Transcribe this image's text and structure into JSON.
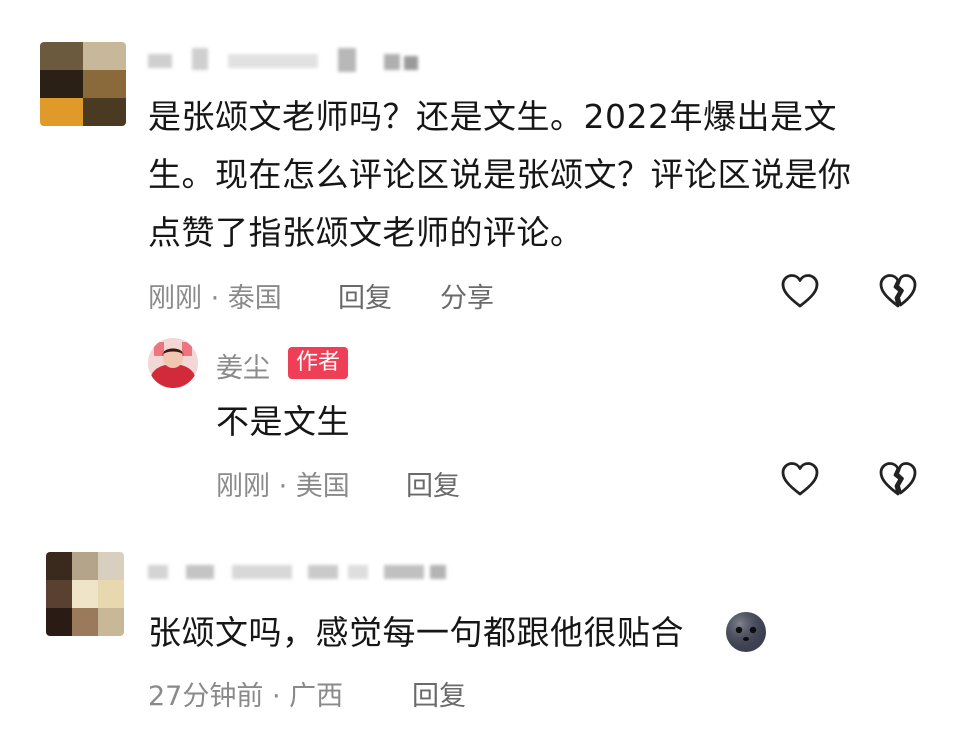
{
  "comments": [
    {
      "text_lines": [
        "是张颂文老师吗？还是文生。2022年爆出是文",
        "生。现在怎么评论区说是张颂文？评论区说是你",
        "点赞了指张颂文老师的评论。"
      ],
      "time": "刚刚",
      "location": "泰国",
      "reply_label": "回复",
      "share_label": "分享"
    },
    {
      "reply": {
        "author": "姜尘",
        "badge": "作者",
        "text": "不是文生",
        "time": "刚刚",
        "location": "美国",
        "reply_label": "回复"
      }
    },
    {
      "text": "张颂文吗，感觉每一句都跟他很贴合",
      "time": "27分钟前",
      "location": "广西",
      "reply_label": "回复"
    }
  ],
  "meta_separator": "·",
  "colors": {
    "badge": "#ee3f56",
    "text": "#161616",
    "meta": "#8a8a8a",
    "action": "#6a6a6a"
  },
  "icons": [
    "like-heart-icon",
    "dislike-broken-heart-icon",
    "ghost-emoji-icon"
  ]
}
